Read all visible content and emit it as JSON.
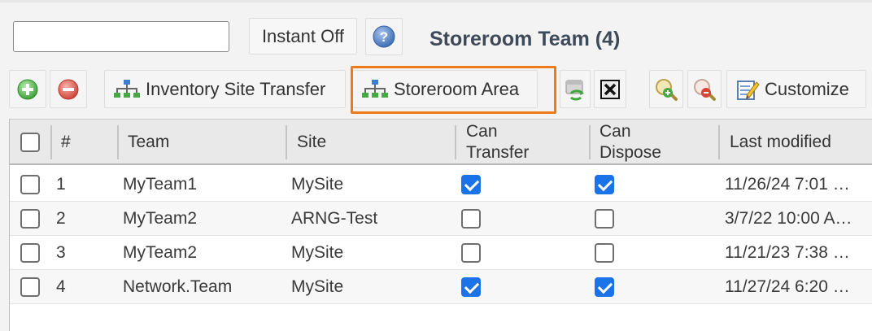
{
  "search": {
    "value": "",
    "placeholder": ""
  },
  "toolbar": {
    "instant_label": "Instant Off",
    "help_icon": "help-icon",
    "title": "Storeroom Team (4)",
    "add_icon": "add-icon",
    "remove_icon": "remove-icon",
    "inventory_site_transfer": "Inventory Site Transfer",
    "storeroom_area": "Storeroom Area",
    "refresh_icon": "refresh-icon",
    "clear_icon": "clear-icon",
    "zoom_in_icon": "zoom-in-icon",
    "zoom_out_icon": "zoom-out-icon",
    "customize": "Customize"
  },
  "colors": {
    "highlight": "#ef7a1a",
    "checkbox": "#1a73e8",
    "title": "#3e4a5a"
  },
  "table": {
    "columns": {
      "number": "#",
      "team": "Team",
      "site": "Site",
      "can_transfer_1": "Can",
      "can_transfer_2": "Transfer",
      "can_dispose_1": "Can",
      "can_dispose_2": "Dispose",
      "last_modified": "Last modified"
    },
    "rows": [
      {
        "num": "1",
        "team": "MyTeam1",
        "site": "MySite",
        "can_transfer": true,
        "can_dispose": true,
        "last_modified": "11/26/24 7:01 …"
      },
      {
        "num": "2",
        "team": "MyTeam2",
        "site": "ARNG-Test",
        "can_transfer": false,
        "can_dispose": false,
        "last_modified": "3/7/22 10:00 A…"
      },
      {
        "num": "3",
        "team": "MyTeam2",
        "site": "MySite",
        "can_transfer": false,
        "can_dispose": false,
        "last_modified": "11/21/23 7:38 …"
      },
      {
        "num": "4",
        "team": "Network.Team",
        "site": "MySite",
        "can_transfer": true,
        "can_dispose": true,
        "last_modified": "11/27/24 6:20 …"
      }
    ]
  }
}
